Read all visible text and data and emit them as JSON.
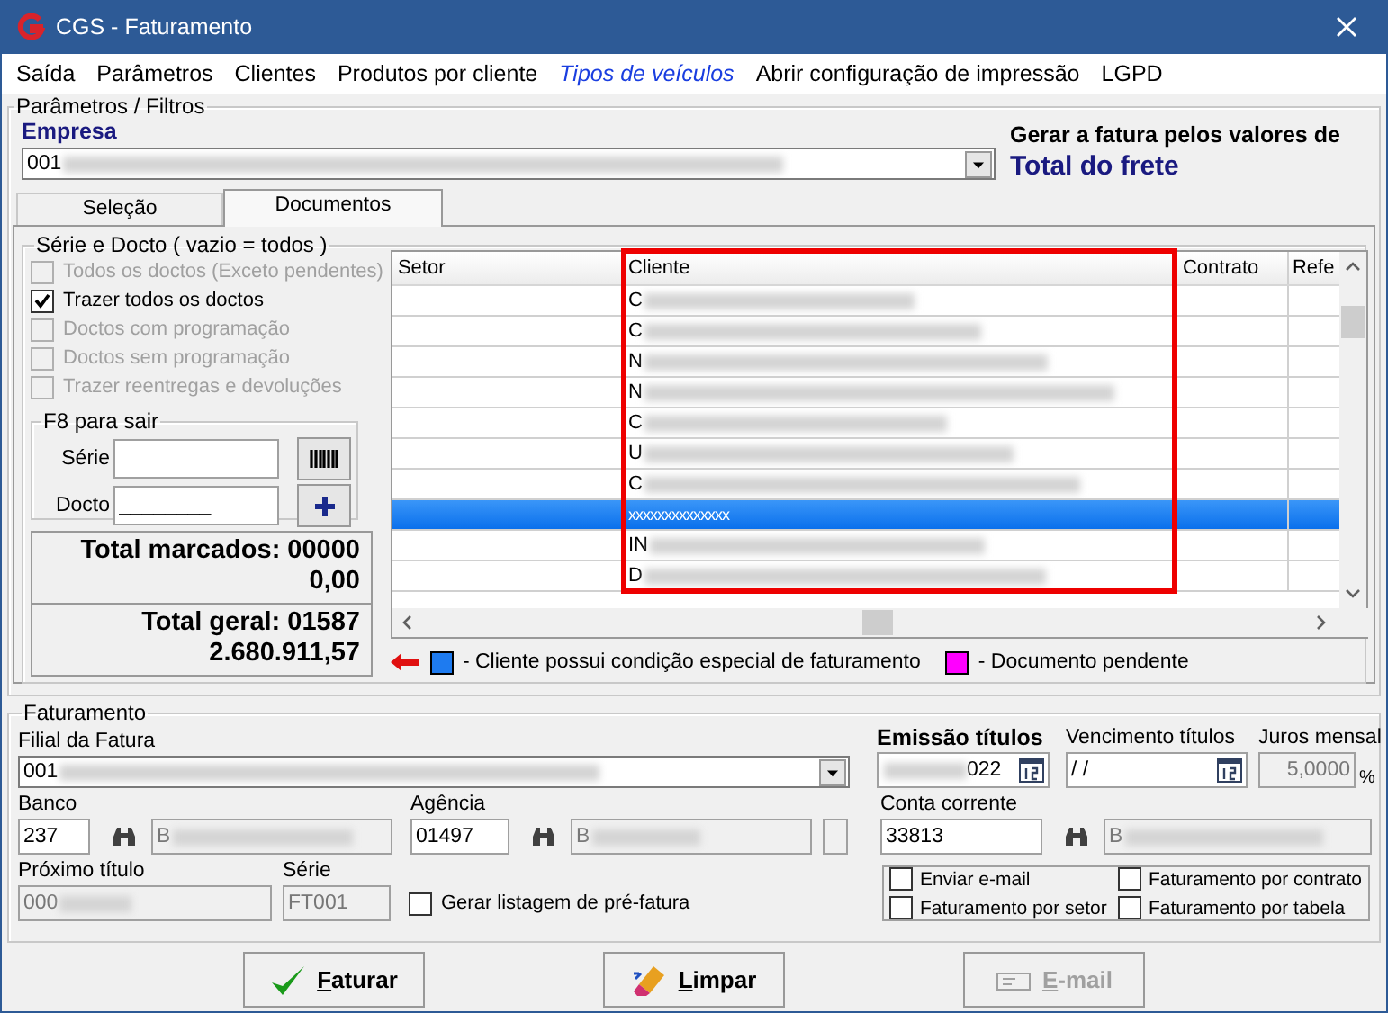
{
  "window": {
    "title": "CGS - Faturamento"
  },
  "menu": [
    {
      "label": "Saída",
      "kind": "item"
    },
    {
      "label": "Parâmetros",
      "kind": "item"
    },
    {
      "label": "Clientes",
      "kind": "item"
    },
    {
      "label": "Produtos por cliente",
      "kind": "item"
    },
    {
      "label": "Tipos de veículos",
      "kind": "link"
    },
    {
      "label": "Abrir configuração de impressão",
      "kind": "item"
    },
    {
      "label": "LGPD",
      "kind": "item"
    }
  ],
  "parametros": {
    "title": "Parâmetros / Filtros",
    "empresa_label": "Empresa",
    "empresa_value": "001",
    "gerar_label": "Gerar a fatura pelos valores de",
    "gerar_value": "Total do frete"
  },
  "tabs": [
    {
      "label": "Seleção",
      "selected": false
    },
    {
      "label": "Documentos",
      "selected": true
    }
  ],
  "serie_docto": {
    "title": "Série e Docto  ( vazio = todos )",
    "options": [
      {
        "label": "Todos os doctos (Exceto pendentes)",
        "checked": false,
        "disabled": true
      },
      {
        "label": "Trazer todos os doctos",
        "checked": true,
        "disabled": false
      },
      {
        "label": "Doctos com programação",
        "checked": false,
        "disabled": true
      },
      {
        "label": "Doctos sem programação",
        "checked": false,
        "disabled": true
      },
      {
        "label": "Trazer reentregas e devoluções",
        "checked": false,
        "disabled": true
      }
    ],
    "f8": {
      "title": "F8 para sair",
      "serie_label": "Série",
      "docto_label": "Docto",
      "docto_value": "________"
    },
    "totals": {
      "marcados": "Total marcados: 00000",
      "marcados_valor": "0,00",
      "geral": "Total geral: 01587",
      "geral_valor": "2.680.911,57"
    }
  },
  "grid": {
    "columns": [
      "Setor",
      "Cliente",
      "Contrato",
      "Refe"
    ],
    "rows": [
      {
        "cliente": "C",
        "blurred": true,
        "selected": false
      },
      {
        "cliente": "C",
        "blurred": true,
        "selected": false
      },
      {
        "cliente": "N",
        "blurred": true,
        "selected": false
      },
      {
        "cliente": "N",
        "blurred": true,
        "selected": false
      },
      {
        "cliente": "C",
        "blurred": true,
        "selected": false
      },
      {
        "cliente": "U",
        "blurred": true,
        "selected": false
      },
      {
        "cliente": "C",
        "blurred": true,
        "selected": false
      },
      {
        "cliente": "xxxxxxxxxxxxxx",
        "blurred": false,
        "selected": true
      },
      {
        "cliente": "IN",
        "blurred": true,
        "selected": false
      },
      {
        "cliente": "D",
        "blurred": true,
        "selected": false
      }
    ]
  },
  "legend": [
    {
      "color": "#1e7bf0",
      "label": "- Cliente possui condição especial de faturamento"
    },
    {
      "color": "#ff00ff",
      "label": "- Documento pendente"
    }
  ],
  "faturamento": {
    "title": "Faturamento",
    "filial_label": "Filial da Fatura",
    "filial_value": "001",
    "emissao_label": "Emissão títulos",
    "emissao_value": "022",
    "vencimento_label": "Vencimento títulos",
    "vencimento_value": "/ /",
    "juros_label": "Juros mensal",
    "juros_value": "5,0000",
    "juros_unit": "%",
    "banco_label": "Banco",
    "banco_value": "237",
    "banco_nome": "B",
    "agencia_label": "Agência",
    "agencia_value": "01497",
    "agencia_nome": "B",
    "conta_label": "Conta corrente",
    "conta_value": "33813",
    "conta_nome": "B",
    "proximo_label": "Próximo título",
    "proximo_value": "000",
    "serie_label": "Série",
    "serie_value": "FT001",
    "pre_fatura": {
      "label": "Gerar listagem de pré-fatura",
      "checked": false
    },
    "options": [
      {
        "label": "Enviar e-mail",
        "checked": false
      },
      {
        "label": "Faturamento por contrato",
        "checked": false
      },
      {
        "label": "Faturamento por setor",
        "checked": false
      },
      {
        "label": "Faturamento por tabela",
        "checked": false
      }
    ]
  },
  "buttons": [
    {
      "label": "Faturar",
      "kind": "faturar",
      "disabled": false
    },
    {
      "label": "Limpar",
      "kind": "limpar",
      "disabled": false
    },
    {
      "label": "E-mail",
      "kind": "email",
      "disabled": true
    }
  ]
}
